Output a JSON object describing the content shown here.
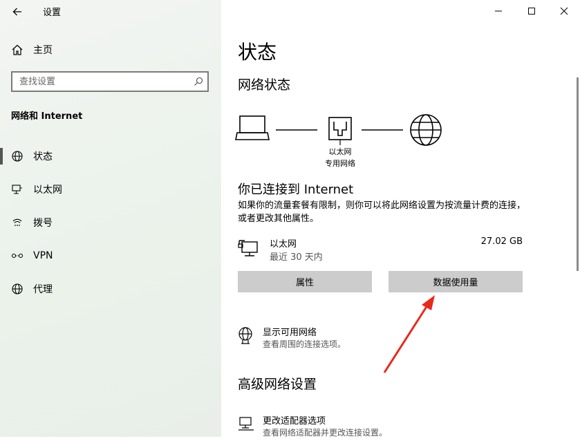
{
  "app": {
    "title": "设置"
  },
  "sidebar": {
    "home_label": "主页",
    "search_placeholder": "查找设置",
    "section_title": "网络和 Internet",
    "items": [
      {
        "label": "状态",
        "icon": "globe-icon"
      },
      {
        "label": "以太网",
        "icon": "ethernet-icon"
      },
      {
        "label": "拨号",
        "icon": "dialup-icon"
      },
      {
        "label": "VPN",
        "icon": "vpn-icon"
      },
      {
        "label": "代理",
        "icon": "proxy-globe-icon"
      }
    ]
  },
  "main": {
    "page_title": "状态",
    "network_status_heading": "网络状态",
    "diagram": {
      "network_label": "以太网",
      "network_sub": "专用网络"
    },
    "connected_title": "你已连接到 Internet",
    "connected_desc": "如果你的流量套餐有限制，则你可以将此网络设置为按流量计费的连接，或者更改其他属性。",
    "ethernet": {
      "name": "以太网",
      "period": "最近 30 天内",
      "usage": "27.02 GB"
    },
    "buttons": {
      "properties": "属性",
      "data_usage": "数据使用量"
    },
    "show_networks": {
      "title": "显示可用网络",
      "sub": "查看周围的连接选项。"
    },
    "advanced_heading": "高级网络设置",
    "adapter_options": {
      "title": "更改适配器选项",
      "sub": "查看网络适配器并更改连接设置。"
    }
  },
  "colors": {
    "accent_arrow": "#e8291c",
    "button_bg": "#cccccc"
  }
}
